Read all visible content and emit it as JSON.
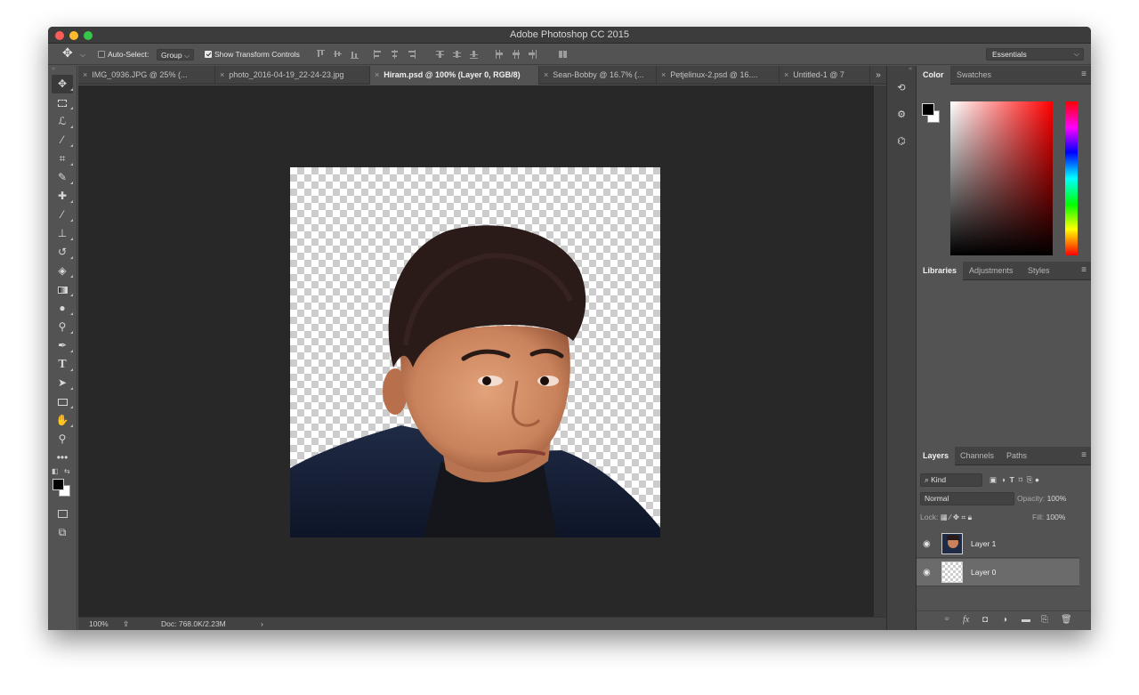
{
  "window": {
    "title": "Adobe Photoshop CC 2015"
  },
  "options_bar": {
    "auto_select_label": "Auto-Select:",
    "auto_select_checked": false,
    "auto_select_mode": "Group",
    "show_transform_label": "Show Transform Controls",
    "show_transform_checked": true,
    "workspace": "Essentials"
  },
  "document_tabs": [
    {
      "label": "IMG_0936.JPG @ 25% (...",
      "active": false
    },
    {
      "label": "photo_2016-04-19_22-24-23.jpg",
      "active": false
    },
    {
      "label": "Hiram.psd @ 100% (Layer 0, RGB/8)",
      "active": true
    },
    {
      "label": "Sean-Bobby @ 16.7% (...",
      "active": false
    },
    {
      "label": "Petjelinux-2.psd @ 16....",
      "active": false
    },
    {
      "label": "Untitled-1 @ 7",
      "active": false
    }
  ],
  "tabs_overflow": "»",
  "tab_close_glyph": "×",
  "status_bar": {
    "zoom": "100%",
    "doc_info": "Doc: 768.0K/2.23M",
    "arrow": "›"
  },
  "color_panel": {
    "tabs": [
      "Color",
      "Swatches"
    ],
    "active_tab": "Color",
    "foreground": "#000000",
    "background": "#ffffff"
  },
  "libraries_panel": {
    "tabs": [
      "Libraries",
      "Adjustments",
      "Styles"
    ],
    "active_tab": "Libraries"
  },
  "layers_panel": {
    "tabs": [
      "Layers",
      "Channels",
      "Paths"
    ],
    "active_tab": "Layers",
    "filter_kind": "Kind",
    "blend_mode": "Normal",
    "opacity_label": "Opacity:",
    "opacity": "100%",
    "lock_label": "Lock:",
    "fill_label": "Fill:",
    "fill": "100%",
    "layers": [
      {
        "name": "Layer 1",
        "visible": true,
        "selected": false,
        "thumbnail": "photo"
      },
      {
        "name": "Layer 0",
        "visible": true,
        "selected": true,
        "thumbnail": "transparent"
      }
    ]
  },
  "icons": {
    "move": "move-icon",
    "marquee": "rect-marquee-icon",
    "lasso": "lasso-icon",
    "quick_select": "quick-select-icon",
    "crop": "crop-icon",
    "eyedropper": "eyedropper-icon",
    "healing": "healing-brush-icon",
    "brush": "brush-icon",
    "stamp": "clone-stamp-icon",
    "history_brush": "history-brush-icon",
    "eraser": "eraser-icon",
    "gradient": "gradient-icon",
    "blur": "blur-icon",
    "dodge": "dodge-icon",
    "pen": "pen-icon",
    "type": "type-icon",
    "path_select": "path-select-icon",
    "shape": "rectangle-shape-icon",
    "hand": "hand-icon",
    "zoom": "zoom-icon",
    "more": "more-tools-icon"
  },
  "colors": {
    "ui_panel": "#535353",
    "ui_dark": "#424242",
    "canvas_bg": "#282828",
    "traffic_red": "#fc5d57",
    "traffic_yellow": "#fdbb2e",
    "traffic_green": "#34c84a"
  }
}
